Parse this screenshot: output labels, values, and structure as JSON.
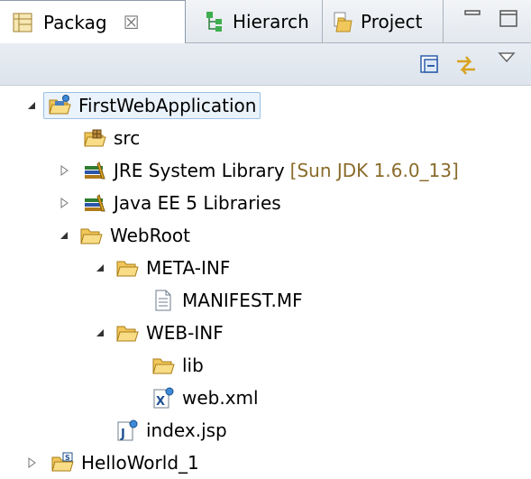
{
  "tabs": [
    {
      "label": "Packag",
      "close": "☒",
      "icon": "package-explorer-icon"
    },
    {
      "label": "Hierarch",
      "icon": "hierarchy-icon"
    },
    {
      "label": "Project",
      "icon": "project-explorer-icon"
    }
  ],
  "toolbar": {
    "collapse_icon": "collapse-all-icon",
    "link_icon": "link-with-editor-icon",
    "menu_icon": "view-menu-icon"
  },
  "tree": {
    "project": {
      "label": "FirstWebApplication",
      "expanded": true
    },
    "src": {
      "label": "src"
    },
    "jre": {
      "label": "JRE System Library",
      "decoration": "[Sun JDK 1.6.0_13]"
    },
    "javaee": {
      "label": "Java EE 5 Libraries"
    },
    "webroot": {
      "label": "WebRoot"
    },
    "metainf": {
      "label": "META-INF"
    },
    "manifest": {
      "label": "MANIFEST.MF"
    },
    "webinf": {
      "label": "WEB-INF"
    },
    "lib": {
      "label": "lib"
    },
    "webxml": {
      "label": "web.xml"
    },
    "indexjsp": {
      "label": "index.jsp"
    },
    "helloworld": {
      "label": "HelloWorld_1"
    }
  },
  "colors": {
    "selection_bg": "#eaf2fb",
    "selection_border": "#9bc0e6",
    "decoration_text": "#8a6b2a",
    "folder": "#e8b74a"
  }
}
